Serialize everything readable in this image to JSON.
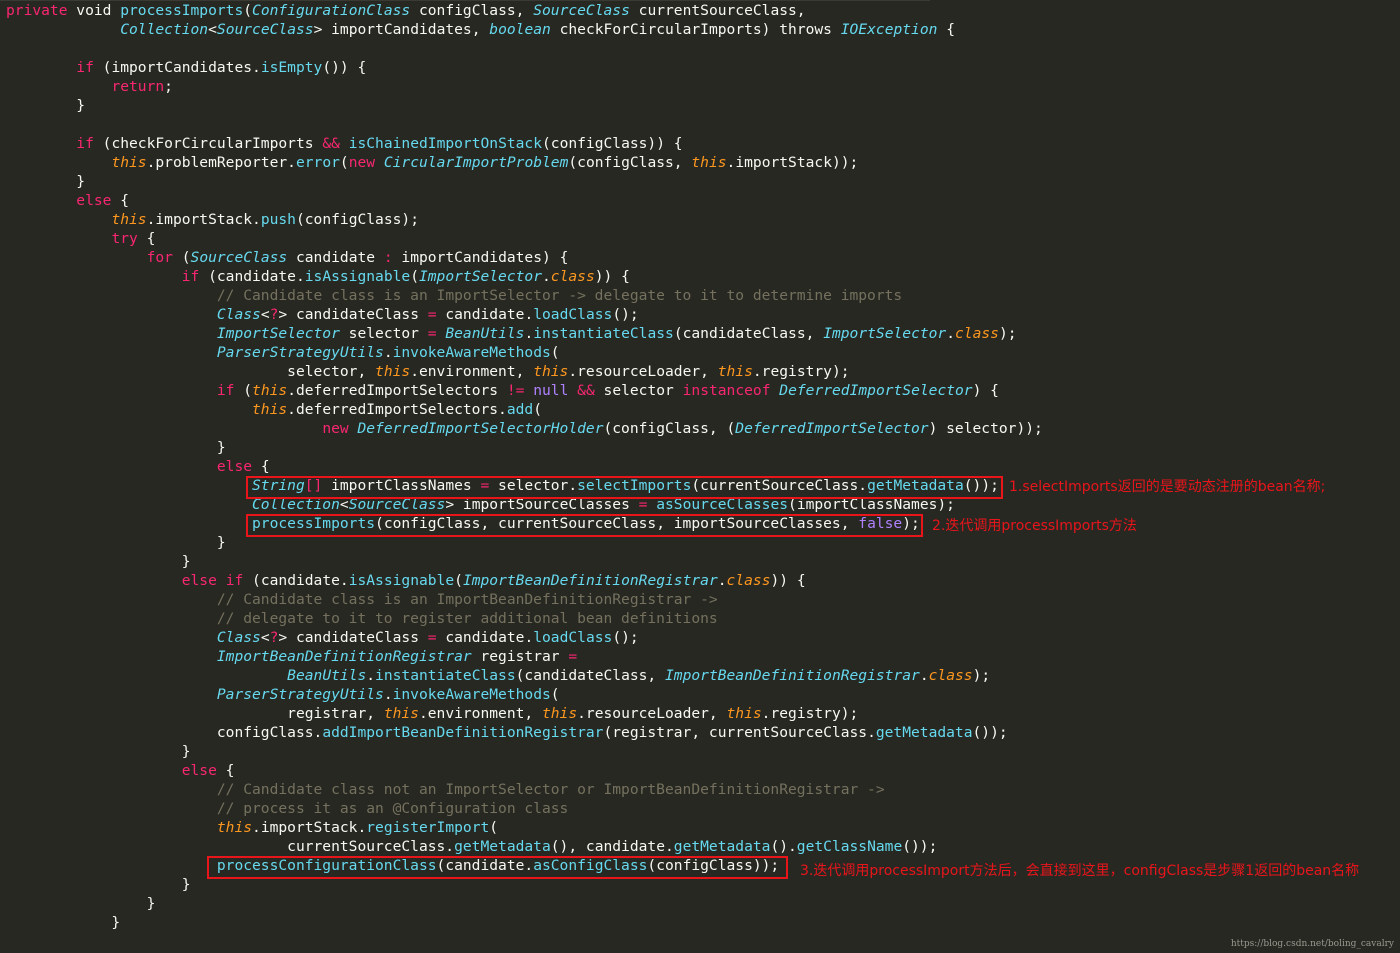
{
  "code": {
    "lines": [
      [
        [
          "kw",
          "private"
        ],
        [
          "t",
          " void "
        ],
        [
          "fn",
          "processImports"
        ],
        [
          "t",
          "("
        ],
        [
          "ty",
          "ConfigurationClass"
        ],
        [
          "t",
          " configClass, "
        ],
        [
          "ty",
          "SourceClass"
        ],
        [
          "t",
          " currentSourceClass,"
        ]
      ],
      [
        [
          "t",
          "             "
        ],
        [
          "ty",
          "Collection"
        ],
        [
          "t",
          "<"
        ],
        [
          "ty",
          "SourceClass"
        ],
        [
          "t",
          "> importCandidates, "
        ],
        [
          "ty",
          "boolean"
        ],
        [
          "t",
          " checkForCircularImports) throws "
        ],
        [
          "ty",
          "IOException"
        ],
        [
          "t",
          " {"
        ]
      ],
      [],
      [
        [
          "t",
          "        "
        ],
        [
          "kw",
          "if"
        ],
        [
          "t",
          " (importCandidates."
        ],
        [
          "fn",
          "isEmpty"
        ],
        [
          "t",
          "()) {"
        ]
      ],
      [
        [
          "t",
          "            "
        ],
        [
          "kw",
          "return"
        ],
        [
          "t",
          ";"
        ]
      ],
      [
        [
          "t",
          "        }"
        ]
      ],
      [],
      [
        [
          "t",
          "        "
        ],
        [
          "kw",
          "if"
        ],
        [
          "t",
          " (checkForCircularImports "
        ],
        [
          "kw",
          "&&"
        ],
        [
          "t",
          " "
        ],
        [
          "fn",
          "isChainedImportOnStack"
        ],
        [
          "t",
          "(configClass)) {"
        ]
      ],
      [
        [
          "t",
          "            "
        ],
        [
          "th",
          "this"
        ],
        [
          "t",
          ".problemReporter."
        ],
        [
          "fn",
          "error"
        ],
        [
          "t",
          "("
        ],
        [
          "kw",
          "new"
        ],
        [
          "t",
          " "
        ],
        [
          "ty",
          "CircularImportProblem"
        ],
        [
          "t",
          "(configClass, "
        ],
        [
          "th",
          "this"
        ],
        [
          "t",
          ".importStack));"
        ]
      ],
      [
        [
          "t",
          "        }"
        ]
      ],
      [
        [
          "t",
          "        "
        ],
        [
          "kw",
          "else"
        ],
        [
          "t",
          " {"
        ]
      ],
      [
        [
          "t",
          "            "
        ],
        [
          "th",
          "this"
        ],
        [
          "t",
          ".importStack."
        ],
        [
          "fn",
          "push"
        ],
        [
          "t",
          "(configClass);"
        ]
      ],
      [
        [
          "t",
          "            "
        ],
        [
          "kw",
          "try"
        ],
        [
          "t",
          " {"
        ]
      ],
      [
        [
          "t",
          "                "
        ],
        [
          "kw",
          "for"
        ],
        [
          "t",
          " ("
        ],
        [
          "ty",
          "SourceClass"
        ],
        [
          "t",
          " candidate "
        ],
        [
          "kw",
          ":"
        ],
        [
          "t",
          " importCandidates) {"
        ]
      ],
      [
        [
          "t",
          "                    "
        ],
        [
          "kw",
          "if"
        ],
        [
          "t",
          " (candidate."
        ],
        [
          "fn",
          "isAssignable"
        ],
        [
          "t",
          "("
        ],
        [
          "ty",
          "ImportSelector"
        ],
        [
          "t",
          "."
        ],
        [
          "th",
          "class"
        ],
        [
          "t",
          ")) {"
        ]
      ],
      [
        [
          "t",
          "                        "
        ],
        [
          "cm",
          "// Candidate class is an ImportSelector -> delegate to it to determine imports"
        ]
      ],
      [
        [
          "t",
          "                        "
        ],
        [
          "ty",
          "Class"
        ],
        [
          "t",
          "<"
        ],
        [
          "kw",
          "?"
        ],
        [
          "t",
          "> candidateClass "
        ],
        [
          "kw",
          "="
        ],
        [
          "t",
          " candidate."
        ],
        [
          "fn",
          "loadClass"
        ],
        [
          "t",
          "();"
        ]
      ],
      [
        [
          "t",
          "                        "
        ],
        [
          "ty",
          "ImportSelector"
        ],
        [
          "t",
          " selector "
        ],
        [
          "kw",
          "="
        ],
        [
          "t",
          " "
        ],
        [
          "ty",
          "BeanUtils"
        ],
        [
          "t",
          "."
        ],
        [
          "fn",
          "instantiateClass"
        ],
        [
          "t",
          "(candidateClass, "
        ],
        [
          "ty",
          "ImportSelector"
        ],
        [
          "t",
          "."
        ],
        [
          "th",
          "class"
        ],
        [
          "t",
          ");"
        ]
      ],
      [
        [
          "t",
          "                        "
        ],
        [
          "ty",
          "ParserStrategyUtils"
        ],
        [
          "t",
          "."
        ],
        [
          "fn",
          "invokeAwareMethods"
        ],
        [
          "t",
          "("
        ]
      ],
      [
        [
          "t",
          "                                selector, "
        ],
        [
          "th",
          "this"
        ],
        [
          "t",
          ".environment, "
        ],
        [
          "th",
          "this"
        ],
        [
          "t",
          ".resourceLoader, "
        ],
        [
          "th",
          "this"
        ],
        [
          "t",
          ".registry);"
        ]
      ],
      [
        [
          "t",
          "                        "
        ],
        [
          "kw",
          "if"
        ],
        [
          "t",
          " ("
        ],
        [
          "th",
          "this"
        ],
        [
          "t",
          ".deferredImportSelectors "
        ],
        [
          "kw",
          "!="
        ],
        [
          "t",
          " "
        ],
        [
          "lit",
          "null"
        ],
        [
          "t",
          " "
        ],
        [
          "kw",
          "&&"
        ],
        [
          "t",
          " selector "
        ],
        [
          "kw",
          "instanceof"
        ],
        [
          "t",
          " "
        ],
        [
          "ty",
          "DeferredImportSelector"
        ],
        [
          "t",
          ") {"
        ]
      ],
      [
        [
          "t",
          "                            "
        ],
        [
          "th",
          "this"
        ],
        [
          "t",
          ".deferredImportSelectors."
        ],
        [
          "fn",
          "add"
        ],
        [
          "t",
          "("
        ]
      ],
      [
        [
          "t",
          "                                    "
        ],
        [
          "kw",
          "new"
        ],
        [
          "t",
          " "
        ],
        [
          "ty",
          "DeferredImportSelectorHolder"
        ],
        [
          "t",
          "(configClass, ("
        ],
        [
          "ty",
          "DeferredImportSelector"
        ],
        [
          "t",
          ") selector));"
        ]
      ],
      [
        [
          "t",
          "                        }"
        ]
      ],
      [
        [
          "t",
          "                        "
        ],
        [
          "kw",
          "else"
        ],
        [
          "t",
          " {"
        ]
      ],
      [
        [
          "t",
          "                            "
        ],
        [
          "ty",
          "String"
        ],
        [
          "kw",
          "[]"
        ],
        [
          "t",
          " importClassNames "
        ],
        [
          "kw",
          "="
        ],
        [
          "t",
          " selector."
        ],
        [
          "fn",
          "selectImports"
        ],
        [
          "t",
          "(currentSourceClass."
        ],
        [
          "fn",
          "getMetadata"
        ],
        [
          "t",
          "());"
        ]
      ],
      [
        [
          "t",
          "                            "
        ],
        [
          "ty",
          "Collection"
        ],
        [
          "t",
          "<"
        ],
        [
          "ty",
          "SourceClass"
        ],
        [
          "t",
          "> importSourceClasses "
        ],
        [
          "kw",
          "="
        ],
        [
          "t",
          " "
        ],
        [
          "fn",
          "asSourceClasses"
        ],
        [
          "t",
          "(importClassNames);"
        ]
      ],
      [
        [
          "t",
          "                            "
        ],
        [
          "fn",
          "processImports"
        ],
        [
          "t",
          "(configClass, currentSourceClass, importSourceClasses, "
        ],
        [
          "lit",
          "false"
        ],
        [
          "t",
          ");"
        ]
      ],
      [
        [
          "t",
          "                        }"
        ]
      ],
      [
        [
          "t",
          "                    }"
        ]
      ],
      [
        [
          "t",
          "                    "
        ],
        [
          "kw",
          "else"
        ],
        [
          "t",
          " "
        ],
        [
          "kw",
          "if"
        ],
        [
          "t",
          " (candidate."
        ],
        [
          "fn",
          "isAssignable"
        ],
        [
          "t",
          "("
        ],
        [
          "ty",
          "ImportBeanDefinitionRegistrar"
        ],
        [
          "t",
          "."
        ],
        [
          "th",
          "class"
        ],
        [
          "t",
          ")) {"
        ]
      ],
      [
        [
          "t",
          "                        "
        ],
        [
          "cm",
          "// Candidate class is an ImportBeanDefinitionRegistrar ->"
        ]
      ],
      [
        [
          "t",
          "                        "
        ],
        [
          "cm",
          "// delegate to it to register additional bean definitions"
        ]
      ],
      [
        [
          "t",
          "                        "
        ],
        [
          "ty",
          "Class"
        ],
        [
          "t",
          "<"
        ],
        [
          "kw",
          "?"
        ],
        [
          "t",
          "> candidateClass "
        ],
        [
          "kw",
          "="
        ],
        [
          "t",
          " candidate."
        ],
        [
          "fn",
          "loadClass"
        ],
        [
          "t",
          "();"
        ]
      ],
      [
        [
          "t",
          "                        "
        ],
        [
          "ty",
          "ImportBeanDefinitionRegistrar"
        ],
        [
          "t",
          " registrar "
        ],
        [
          "kw",
          "="
        ]
      ],
      [
        [
          "t",
          "                                "
        ],
        [
          "ty",
          "BeanUtils"
        ],
        [
          "t",
          "."
        ],
        [
          "fn",
          "instantiateClass"
        ],
        [
          "t",
          "(candidateClass, "
        ],
        [
          "ty",
          "ImportBeanDefinitionRegistrar"
        ],
        [
          "t",
          "."
        ],
        [
          "th",
          "class"
        ],
        [
          "t",
          ");"
        ]
      ],
      [
        [
          "t",
          "                        "
        ],
        [
          "ty",
          "ParserStrategyUtils"
        ],
        [
          "t",
          "."
        ],
        [
          "fn",
          "invokeAwareMethods"
        ],
        [
          "t",
          "("
        ]
      ],
      [
        [
          "t",
          "                                registrar, "
        ],
        [
          "th",
          "this"
        ],
        [
          "t",
          ".environment, "
        ],
        [
          "th",
          "this"
        ],
        [
          "t",
          ".resourceLoader, "
        ],
        [
          "th",
          "this"
        ],
        [
          "t",
          ".registry);"
        ]
      ],
      [
        [
          "t",
          "                        configClass."
        ],
        [
          "fn",
          "addImportBeanDefinitionRegistrar"
        ],
        [
          "t",
          "(registrar, currentSourceClass."
        ],
        [
          "fn",
          "getMetadata"
        ],
        [
          "t",
          "());"
        ]
      ],
      [
        [
          "t",
          "                    }"
        ]
      ],
      [
        [
          "t",
          "                    "
        ],
        [
          "kw",
          "else"
        ],
        [
          "t",
          " {"
        ]
      ],
      [
        [
          "t",
          "                        "
        ],
        [
          "cm",
          "// Candidate class not an ImportSelector or ImportBeanDefinitionRegistrar ->"
        ]
      ],
      [
        [
          "t",
          "                        "
        ],
        [
          "cm",
          "// process it as an @Configuration class"
        ]
      ],
      [
        [
          "t",
          "                        "
        ],
        [
          "th",
          "this"
        ],
        [
          "t",
          ".importStack."
        ],
        [
          "fn",
          "registerImport"
        ],
        [
          "t",
          "("
        ]
      ],
      [
        [
          "t",
          "                                currentSourceClass."
        ],
        [
          "fn",
          "getMetadata"
        ],
        [
          "t",
          "(), candidate."
        ],
        [
          "fn",
          "getMetadata"
        ],
        [
          "t",
          "()."
        ],
        [
          "fn",
          "getClassName"
        ],
        [
          "t",
          "());"
        ]
      ],
      [
        [
          "t",
          "                        "
        ],
        [
          "fn",
          "processConfigurationClass"
        ],
        [
          "t",
          "(candidate."
        ],
        [
          "fn",
          "asConfigClass"
        ],
        [
          "t",
          "(configClass));"
        ]
      ],
      [
        [
          "t",
          "                    }"
        ]
      ],
      [
        [
          "t",
          "                }"
        ]
      ],
      [
        [
          "t",
          "            }"
        ]
      ]
    ]
  },
  "annotations": {
    "note1": "1.selectImports返回的是要动态注册的bean名称;",
    "note2": "2.迭代调用processImports方法",
    "note3": "3.迭代调用processImport方法后，会直接到这里，configClass是步骤1返回的bean名称"
  },
  "watermark": "https://blog.csdn.net/boling_cavalry",
  "colors": {
    "background": "#272822",
    "keyword": "#F92672",
    "type": "#66D9EF",
    "this": "#FD971F",
    "comment": "#75715E",
    "literal": "#AE81FF",
    "annotation": "#E8151B"
  }
}
